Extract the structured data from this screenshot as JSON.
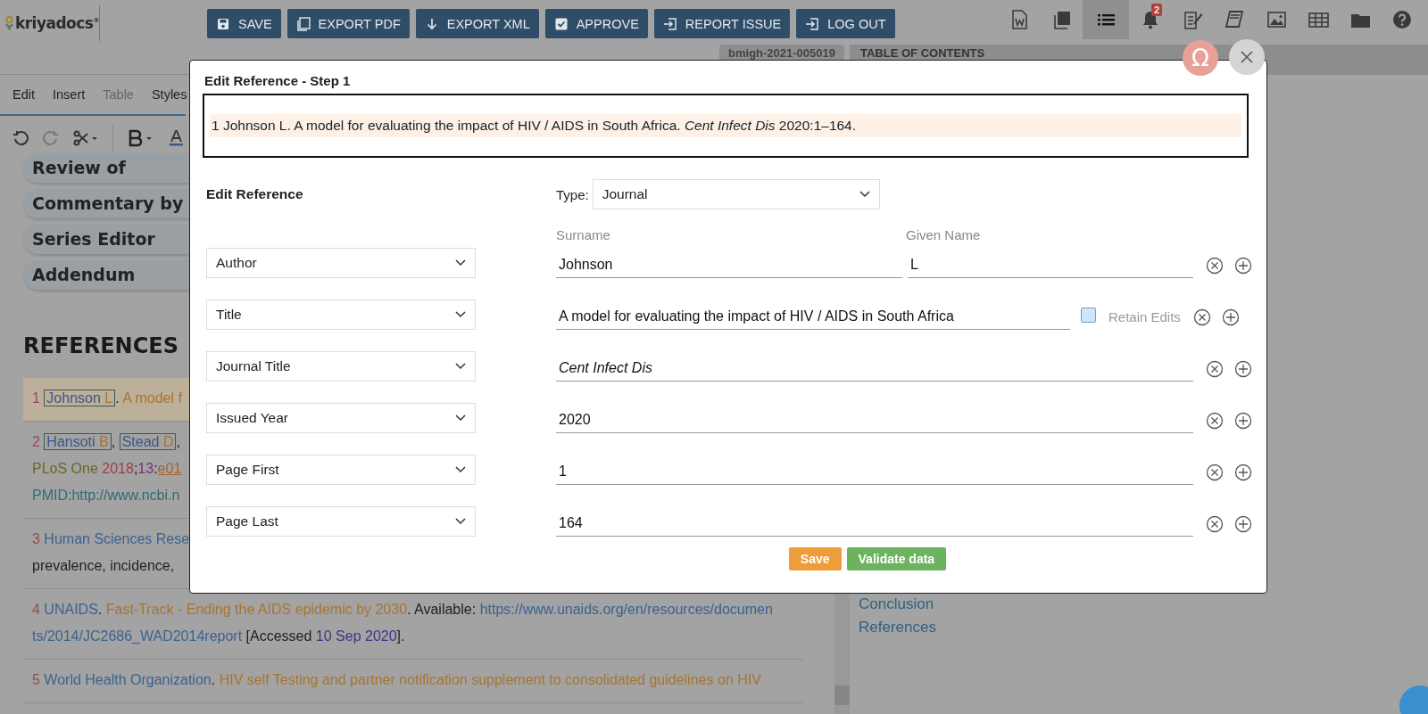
{
  "app": {
    "logo": "kriyadocs$^{®}$"
  },
  "toolbar_buttons": [
    {
      "kind": "save",
      "label": "SAVE"
    },
    {
      "kind": "pdf",
      "label": "EXPORT PDF"
    },
    {
      "kind": "download",
      "label": "EXPORT XML"
    },
    {
      "kind": "check",
      "label": "APPROVE"
    },
    {
      "kind": "enter",
      "label": "REPORT ISSUE"
    },
    {
      "kind": "enter",
      "label": "LOG OUT"
    }
  ],
  "header_icons": [
    {
      "kind": "word",
      "selected": false
    },
    {
      "kind": "pdf",
      "selected": false
    },
    {
      "kind": "list",
      "selected": true
    },
    {
      "kind": "bell",
      "selected": false,
      "badge": "2"
    },
    {
      "kind": "note",
      "selected": false
    },
    {
      "kind": "book",
      "selected": false
    },
    {
      "kind": "image",
      "selected": false
    },
    {
      "kind": "table",
      "selected": false
    },
    {
      "kind": "folder",
      "selected": false
    },
    {
      "kind": "help",
      "selected": false
    }
  ],
  "document_id": "bmigh-2021-005019",
  "editor_menu": [
    {
      "label": "Edit",
      "disabled": false
    },
    {
      "label": "Insert",
      "disabled": false
    },
    {
      "label": "Table",
      "disabled": true
    },
    {
      "label": "Styles",
      "disabled": false
    }
  ],
  "contributor_roles": [
    "Review of",
    "Commentary by",
    "Series Editor",
    "Addendum"
  ],
  "section_heading": "REFERENCES",
  "references": [
    {
      "selected": true,
      "lines": [
        [
          {
            "kind": "number",
            "text": "1"
          },
          {
            "kind": "author",
            "surname": "Johnson",
            "given": "L",
            "trail": "."
          },
          {
            "kind": "title",
            "text": "A model f"
          }
        ]
      ]
    },
    {
      "selected": false,
      "lines": [
        [
          {
            "kind": "number",
            "text": "2"
          },
          {
            "kind": "author",
            "surname": "Hansoti",
            "given": "B",
            "trail": ","
          },
          {
            "kind": "author",
            "surname": "Stead",
            "given": "D",
            "trail": ","
          }
        ],
        [
          {
            "kind": "journal",
            "text": "PLoS One"
          },
          {
            "kind": "year",
            "text": "2018",
            "trail": ";"
          },
          {
            "kind": "volume",
            "text": "13",
            "attach": true,
            "trail": ":"
          },
          {
            "kind": "page",
            "text": "e01",
            "attach": true
          }
        ],
        [
          {
            "kind": "link",
            "text": "PMID:http://www.ncbi.n"
          }
        ]
      ]
    },
    {
      "selected": false,
      "lines": [
        [
          {
            "kind": "number",
            "text": "3"
          },
          {
            "kind": "publisher",
            "text": "Human Sciences Rese"
          }
        ],
        [
          {
            "kind": "plain",
            "text": "prevalence, incidence,"
          }
        ]
      ]
    },
    {
      "selected": false,
      "lines": [
        [
          {
            "kind": "number",
            "text": "4"
          },
          {
            "kind": "publisher",
            "text": "UNAIDS",
            "trail": "."
          },
          {
            "kind": "title",
            "text": "Fast-Track - Ending the AIDS epidemic by 2030",
            "trail": "."
          },
          {
            "kind": "plain",
            "text": "Available:"
          },
          {
            "kind": "url",
            "text": "https://www.unaids.org/en/resources/documen"
          }
        ],
        [
          {
            "kind": "url",
            "text": "ts/2014/JC2686_WAD2014report"
          },
          {
            "kind": "plain",
            "text": "[Accessed"
          },
          {
            "kind": "date",
            "text": "10 Sep 2020",
            "trail": "]."
          }
        ]
      ]
    },
    {
      "selected": false,
      "lines": [
        [
          {
            "kind": "number",
            "text": "5"
          },
          {
            "kind": "publisher",
            "text": "World Health Organization",
            "trail": "."
          },
          {
            "kind": "title",
            "text": "HIV self Testing and partner notification supplement to consolidated guidelines on HIV"
          }
        ]
      ]
    }
  ],
  "toc": {
    "title": "TABLE OF CONTENTS",
    "items": [
      "Conclusion",
      "References"
    ]
  },
  "special_char_button": "Ω",
  "dialog": {
    "title": "Edit Reference - Step 1",
    "preview": "1 Johnson L. A model for evaluating the impact of HIV / AIDS in South Africa. *Cent Infect Dis* 2020:1–164.",
    "section_label": "Edit Reference",
    "type_label": "Type:",
    "type_value": "Journal",
    "column_headers": [
      "Surname",
      "Given Name"
    ],
    "fields": [
      {
        "kind": "name",
        "label": "Author",
        "values": [
          "Johnson",
          "L"
        ]
      },
      {
        "kind": "title",
        "label": "Title",
        "value": "A model for evaluating the impact of HIV / AIDS in South Africa",
        "retain_label": "Retain Edits",
        "retain_checked": false
      },
      {
        "kind": "text",
        "label": "Journal Title",
        "value": "Cent Infect Dis",
        "italic": true
      },
      {
        "kind": "text",
        "label": "Issued Year",
        "value": "2020",
        "italic": false
      },
      {
        "kind": "text",
        "label": "Page First",
        "value": "1",
        "italic": false
      },
      {
        "kind": "text",
        "label": "Page Last",
        "value": "164",
        "italic": false
      }
    ],
    "buttons": [
      {
        "kind": "save",
        "label": "Save"
      },
      {
        "kind": "validate",
        "label": "Validate data"
      }
    ]
  }
}
